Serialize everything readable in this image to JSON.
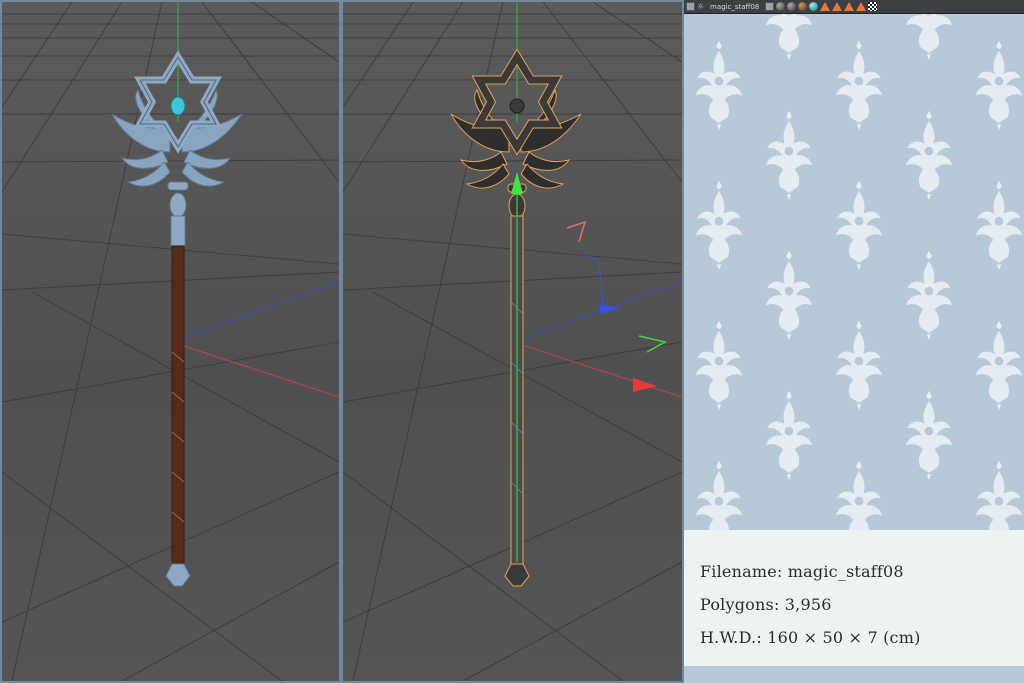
{
  "toolbar": {
    "title": "magic_staff08",
    "icons": [
      "layout-icon",
      "light-icon",
      "box-icon",
      "sphere-icon",
      "sphere-icon",
      "sphere-icon",
      "sphere-icon",
      "cone-icon",
      "cone-icon",
      "cone-icon",
      "cone-icon",
      "checker-icon"
    ]
  },
  "info": {
    "filename": "Filename: magic_staff08",
    "polygons": "Polygons: 3,956",
    "dimensions": "H.W.D.: 160 × 50 × 7 (cm)"
  },
  "colors": {
    "frame": "#6f8aa0",
    "viewport_bg": "#555555",
    "grid": "#3e3e3e",
    "axis_x": "#c8413f",
    "axis_z": "#3a4fc2",
    "axis_y": "#3cb04a",
    "staff_metal": "#8fa9c4",
    "staff_wood": "#5a2a18",
    "gem": "#3ec6d9",
    "selection_outline": "#e8a15a",
    "panel_bg": "#b7c8d8",
    "damask": "#e9eff4",
    "card_bg": "#eef3f1"
  }
}
